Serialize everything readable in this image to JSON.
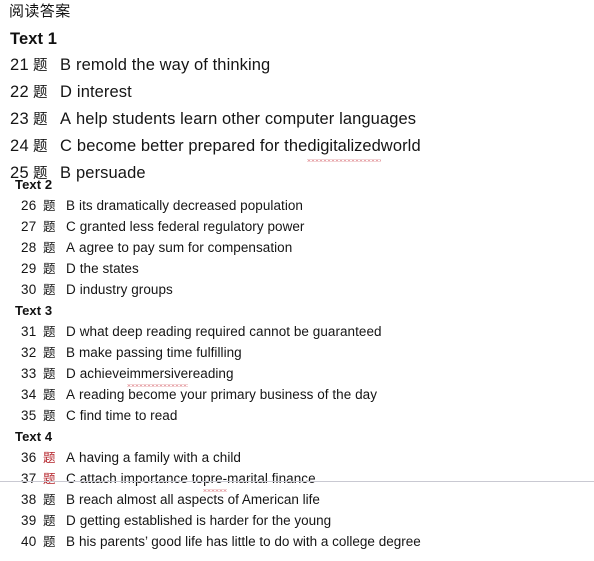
{
  "document": {
    "title": "阅读答案",
    "question_marker": "题"
  },
  "sections": {
    "text1": {
      "heading": "Text 1",
      "rows": [
        {
          "num": "21",
          "ti": "题",
          "option": "B",
          "text": "remold the way of thinking"
        },
        {
          "num": "22",
          "ti": "题",
          "option": "D",
          "text": "interest"
        },
        {
          "num": "23",
          "ti": "题",
          "option": "A",
          "text": "help students learn other computer languages"
        },
        {
          "num": "24",
          "ti": "题",
          "option": "C",
          "text_before": "become better prepared for the ",
          "misspelled": "digitalized",
          "text_after": " world"
        },
        {
          "num": "25",
          "ti": "题",
          "option": "B",
          "text": "persuade"
        }
      ]
    },
    "text2": {
      "heading": "Text 2",
      "rows": [
        {
          "num": "26",
          "ti": "题",
          "option": "B",
          "text": "its dramatically decreased population"
        },
        {
          "num": "27",
          "ti": "题",
          "option": "C",
          "text": "granted less federal regulatory power"
        },
        {
          "num": "28",
          "ti": "题",
          "option": "A",
          "text": "agree to pay sum for compensation"
        },
        {
          "num": "29",
          "ti": "题",
          "option": "D",
          "text": "the states"
        },
        {
          "num": "30",
          "ti": "题",
          "option": "D",
          "text": "industry groups"
        }
      ]
    },
    "text3": {
      "heading": "Text 3",
      "rows": [
        {
          "num": "31",
          "ti": "题",
          "option": "D",
          "text": "what deep reading required cannot be guaranteed"
        },
        {
          "num": "32",
          "ti": "题",
          "option": "B",
          "text": "make passing time fulfilling"
        },
        {
          "num": "33",
          "ti": "题",
          "option": "D",
          "text_before": "achieve ",
          "misspelled": "immersive",
          "text_after": " reading"
        },
        {
          "num": "34",
          "ti": "题",
          "option": "A",
          "text": "reading become your primary business of the day"
        },
        {
          "num": "35",
          "ti": "题",
          "option": "C",
          "text": "find time to read"
        }
      ]
    },
    "text4": {
      "heading": "Text 4",
      "rows": [
        {
          "num": "36",
          "ti": "题",
          "option": "A",
          "text": "having a family with a child"
        },
        {
          "num": "37",
          "ti": "题",
          "option": "C",
          "text_before": "attach importance to ",
          "misspelled": "pre-",
          "text_after": "marital finance"
        }
      ]
    },
    "text5": {
      "rows": [
        {
          "num": "38",
          "ti": "题",
          "option": "B",
          "text": "reach almost all aspects of American life"
        },
        {
          "num": "39",
          "ti": "题",
          "option": "D",
          "text": "getting established is harder for the young"
        },
        {
          "num": "40",
          "ti": "题",
          "option": "B",
          "text": "his parents’ good life has little to do with a college degree"
        }
      ]
    }
  }
}
